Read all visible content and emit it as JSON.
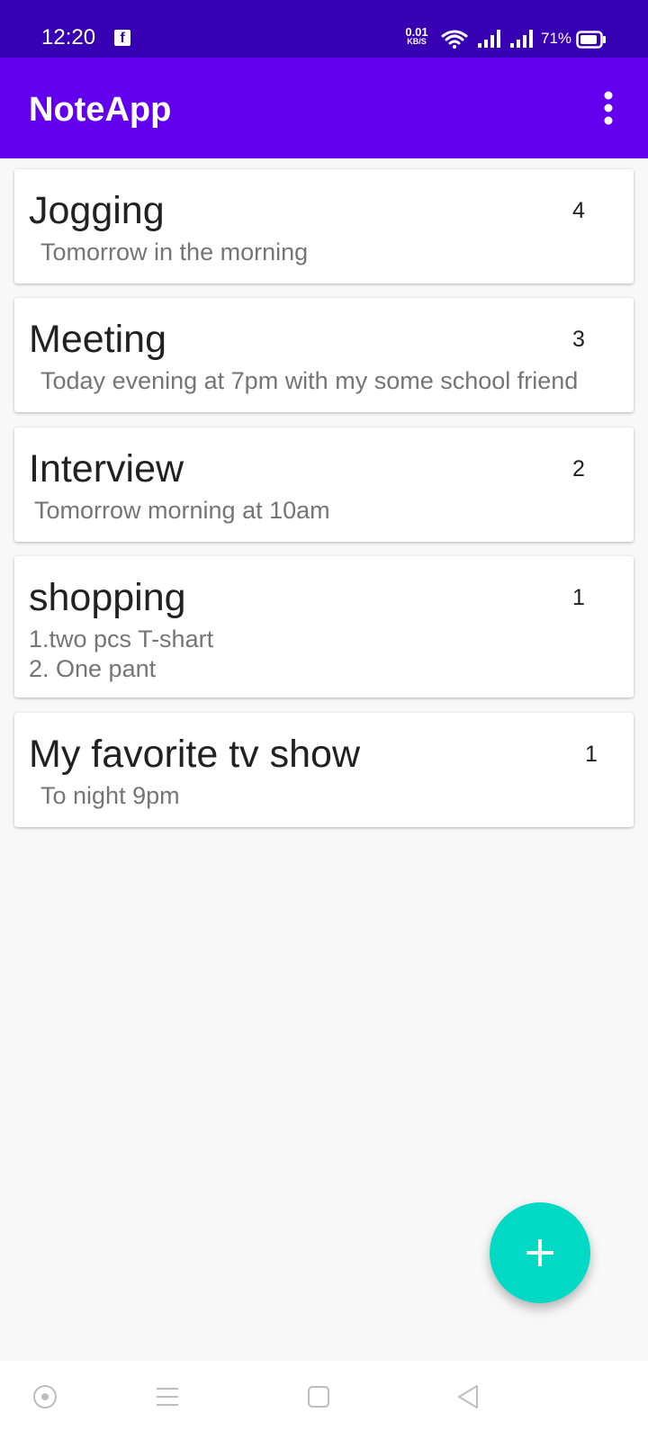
{
  "status_bar": {
    "time": "12:20",
    "notification_icon": "facebook-icon",
    "net_speed_value": "0.01",
    "net_speed_unit": "KB/S",
    "battery_percent": "71%"
  },
  "app_bar": {
    "title": "NoteApp",
    "menu_icon": "more-vert-icon"
  },
  "notes": [
    {
      "title": "Jogging",
      "description": " Tomorrow in the morning",
      "count": "4"
    },
    {
      "title": "Meeting",
      "description": " Today evening at 7pm with my some school friend",
      "count": "3"
    },
    {
      "title": "Interview",
      "description": "Tomorrow morning at 10am",
      "count": "2"
    },
    {
      "title": "shopping",
      "description": "1.two pcs T-shart\n2. One pant",
      "count": "1"
    },
    {
      "title": "My favorite tv show",
      "description": " To night 9pm",
      "count": "1"
    }
  ],
  "fab": {
    "icon": "add-icon"
  },
  "nav_bar": {
    "buttons": [
      "assistant-icon",
      "menu-icon",
      "home-icon",
      "back-icon"
    ]
  },
  "colors": {
    "status_bar": "#3700b3",
    "app_bar": "#6200ee",
    "fab": "#03dac5",
    "background": "#f8f8f8"
  }
}
